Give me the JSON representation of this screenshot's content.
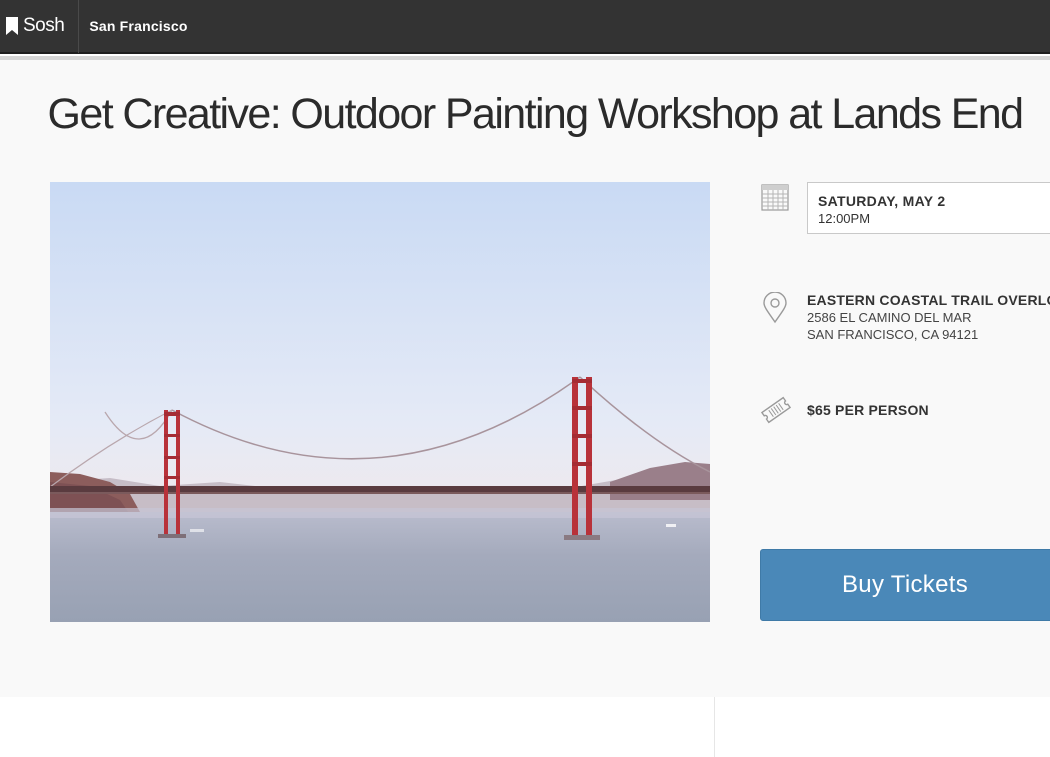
{
  "navbar": {
    "brand": "Sosh",
    "city": "San Francisco",
    "brand_icon": "bookmark-icon"
  },
  "event": {
    "title": "Get Creative: Outdoor Painting Workshop at Lands End",
    "image": "golden-gate-bridge-photo"
  },
  "details": {
    "date": "SATURDAY, MAY 2",
    "time": "12:00PM",
    "date_icon": "calendar-icon",
    "venue_name": "EASTERN COASTAL TRAIL OVERLOOK",
    "address_line1": "2586 EL CAMINO DEL MAR",
    "address_line2": "SAN FRANCISCO, CA 94121",
    "location_icon": "map-pin-icon",
    "price": "$65 PER PERSON",
    "price_icon": "ticket-icon"
  },
  "actions": {
    "buy_label": "Buy Tickets",
    "buy_color": "#4a88b8"
  }
}
